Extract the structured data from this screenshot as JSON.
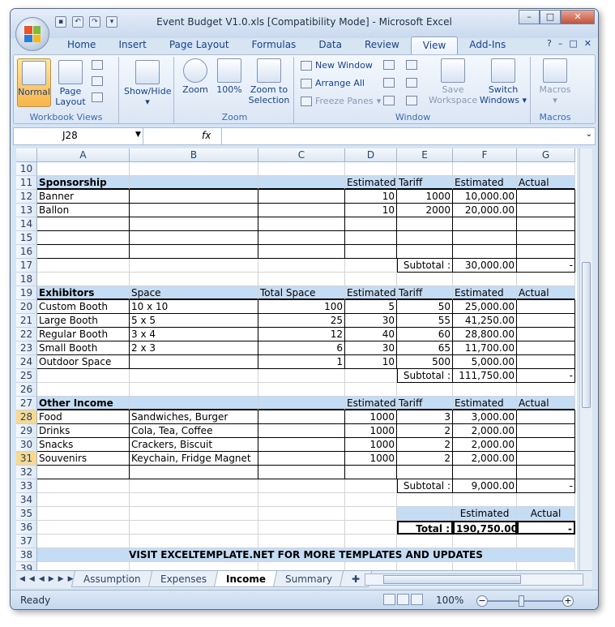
{
  "app": {
    "title": "Event Budget V1.0.xls  [Compatibility Mode] - Microsoft Excel"
  },
  "ribbon_tabs": [
    "Home",
    "Insert",
    "Page Layout",
    "Formulas",
    "Data",
    "Review",
    "View",
    "Add-Ins"
  ],
  "active_tab": "View",
  "ribbon": {
    "workbook_views": {
      "label": "Workbook Views",
      "normal": "Normal",
      "page_layout": "Page Layout"
    },
    "show_hide": {
      "label": "Show/Hide"
    },
    "zoom": {
      "label": "Zoom",
      "zoom": "Zoom",
      "pct100": "100%",
      "zoom_to_selection": "Zoom to Selection"
    },
    "window": {
      "label": "Window",
      "new_window": "New Window",
      "arrange_all": "Arrange All",
      "freeze_panes": "Freeze Panes",
      "save_workspace": "Save Workspace",
      "switch_windows": "Switch Windows"
    },
    "macros": {
      "label": "Macros",
      "macros": "Macros"
    }
  },
  "formula_bar": {
    "name_box": "J28",
    "fx": "fx",
    "formula": ""
  },
  "columns": [
    "A",
    "B",
    "C",
    "D",
    "E",
    "F",
    "G"
  ],
  "rows": [
    {
      "n": "10",
      "cells": [
        "",
        "",
        "",
        "",
        "",
        "",
        ""
      ]
    },
    {
      "n": "11",
      "cells": [
        "Sponsorship",
        "",
        "",
        "Estimated",
        "Tariff",
        "Estimated",
        "Actual"
      ]
    },
    {
      "n": "12",
      "cells": [
        "Banner",
        "",
        "",
        "10",
        "1000",
        "10,000.00",
        ""
      ]
    },
    {
      "n": "13",
      "cells": [
        "Ballon",
        "",
        "",
        "10",
        "2000",
        "20,000.00",
        ""
      ]
    },
    {
      "n": "14",
      "cells": [
        "",
        "",
        "",
        "",
        "",
        "",
        ""
      ]
    },
    {
      "n": "15",
      "cells": [
        "",
        "",
        "",
        "",
        "",
        "",
        ""
      ]
    },
    {
      "n": "16",
      "cells": [
        "",
        "",
        "",
        "",
        "",
        "",
        ""
      ]
    },
    {
      "n": "17",
      "cells": [
        "",
        "",
        "",
        "",
        "Subtotal :",
        "30,000.00",
        "-"
      ]
    },
    {
      "n": "18",
      "cells": [
        "",
        "",
        "",
        "",
        "",
        "",
        ""
      ]
    },
    {
      "n": "19",
      "cells": [
        "Exhibitors",
        "Space",
        "Total Space",
        "Estimated",
        "Tariff",
        "Estimated",
        "Actual"
      ]
    },
    {
      "n": "20",
      "cells": [
        "Custom Booth",
        "10 x 10",
        "100",
        "5",
        "50",
        "25,000.00",
        ""
      ]
    },
    {
      "n": "21",
      "cells": [
        "Large Booth",
        "5 x 5",
        "25",
        "30",
        "55",
        "41,250.00",
        ""
      ]
    },
    {
      "n": "22",
      "cells": [
        "Regular Booth",
        "3 x 4",
        "12",
        "40",
        "60",
        "28,800.00",
        ""
      ]
    },
    {
      "n": "23",
      "cells": [
        "Small Booth",
        "2 x 3",
        "6",
        "30",
        "65",
        "11,700.00",
        ""
      ]
    },
    {
      "n": "24",
      "cells": [
        "Outdoor Space",
        "",
        "1",
        "10",
        "500",
        "5,000.00",
        ""
      ]
    },
    {
      "n": "25",
      "cells": [
        "",
        "",
        "",
        "",
        "Subtotal :",
        "111,750.00",
        "-"
      ]
    },
    {
      "n": "26",
      "cells": [
        "",
        "",
        "",
        "",
        "",
        "",
        ""
      ]
    },
    {
      "n": "27",
      "cells": [
        "Other Income",
        "",
        "",
        "Estimated",
        "Tariff",
        "Estimated",
        "Actual"
      ]
    },
    {
      "n": "28",
      "cells": [
        "Food",
        "Sandwiches, Burger",
        "",
        "1000",
        "3",
        "3,000.00",
        ""
      ]
    },
    {
      "n": "29",
      "cells": [
        "Drinks",
        "Cola, Tea, Coffee",
        "",
        "1000",
        "2",
        "2,000.00",
        ""
      ]
    },
    {
      "n": "30",
      "cells": [
        "Snacks",
        "Crackers, Biscuit",
        "",
        "1000",
        "2",
        "2,000.00",
        ""
      ]
    },
    {
      "n": "31",
      "cells": [
        "Souvenirs",
        "Keychain, Fridge Magnet",
        "",
        "1000",
        "2",
        "2,000.00",
        ""
      ]
    },
    {
      "n": "32",
      "cells": [
        "",
        "",
        "",
        "",
        "",
        "",
        ""
      ]
    },
    {
      "n": "33",
      "cells": [
        "",
        "",
        "",
        "",
        "Subtotal :",
        "9,000.00",
        "-"
      ]
    },
    {
      "n": "34",
      "cells": [
        "",
        "",
        "",
        "",
        "",
        "",
        ""
      ]
    },
    {
      "n": "35",
      "cells": [
        "",
        "",
        "",
        "",
        "",
        "Estimated",
        "Actual"
      ]
    },
    {
      "n": "36",
      "cells": [
        "",
        "",
        "",
        "",
        "Total :",
        "190,750.00",
        "-"
      ]
    },
    {
      "n": "37",
      "cells": [
        "",
        "",
        "",
        "",
        "",
        "",
        ""
      ]
    },
    {
      "n": "38",
      "cells": [
        "VISIT EXCELTEMPLATE.NET FOR MORE TEMPLATES AND UPDATES",
        "",
        "",
        "",
        "",
        "",
        ""
      ]
    },
    {
      "n": "39",
      "cells": [
        "",
        "",
        "",
        "",
        "",
        "",
        ""
      ]
    }
  ],
  "sheet_tabs": [
    "Assumption",
    "Expenses",
    "Income",
    "Summary"
  ],
  "active_sheet": "Income",
  "status": {
    "ready": "Ready",
    "zoom": "100%"
  },
  "colors": {
    "header_fill": "#c5dcf5",
    "accent": "#15428b"
  }
}
